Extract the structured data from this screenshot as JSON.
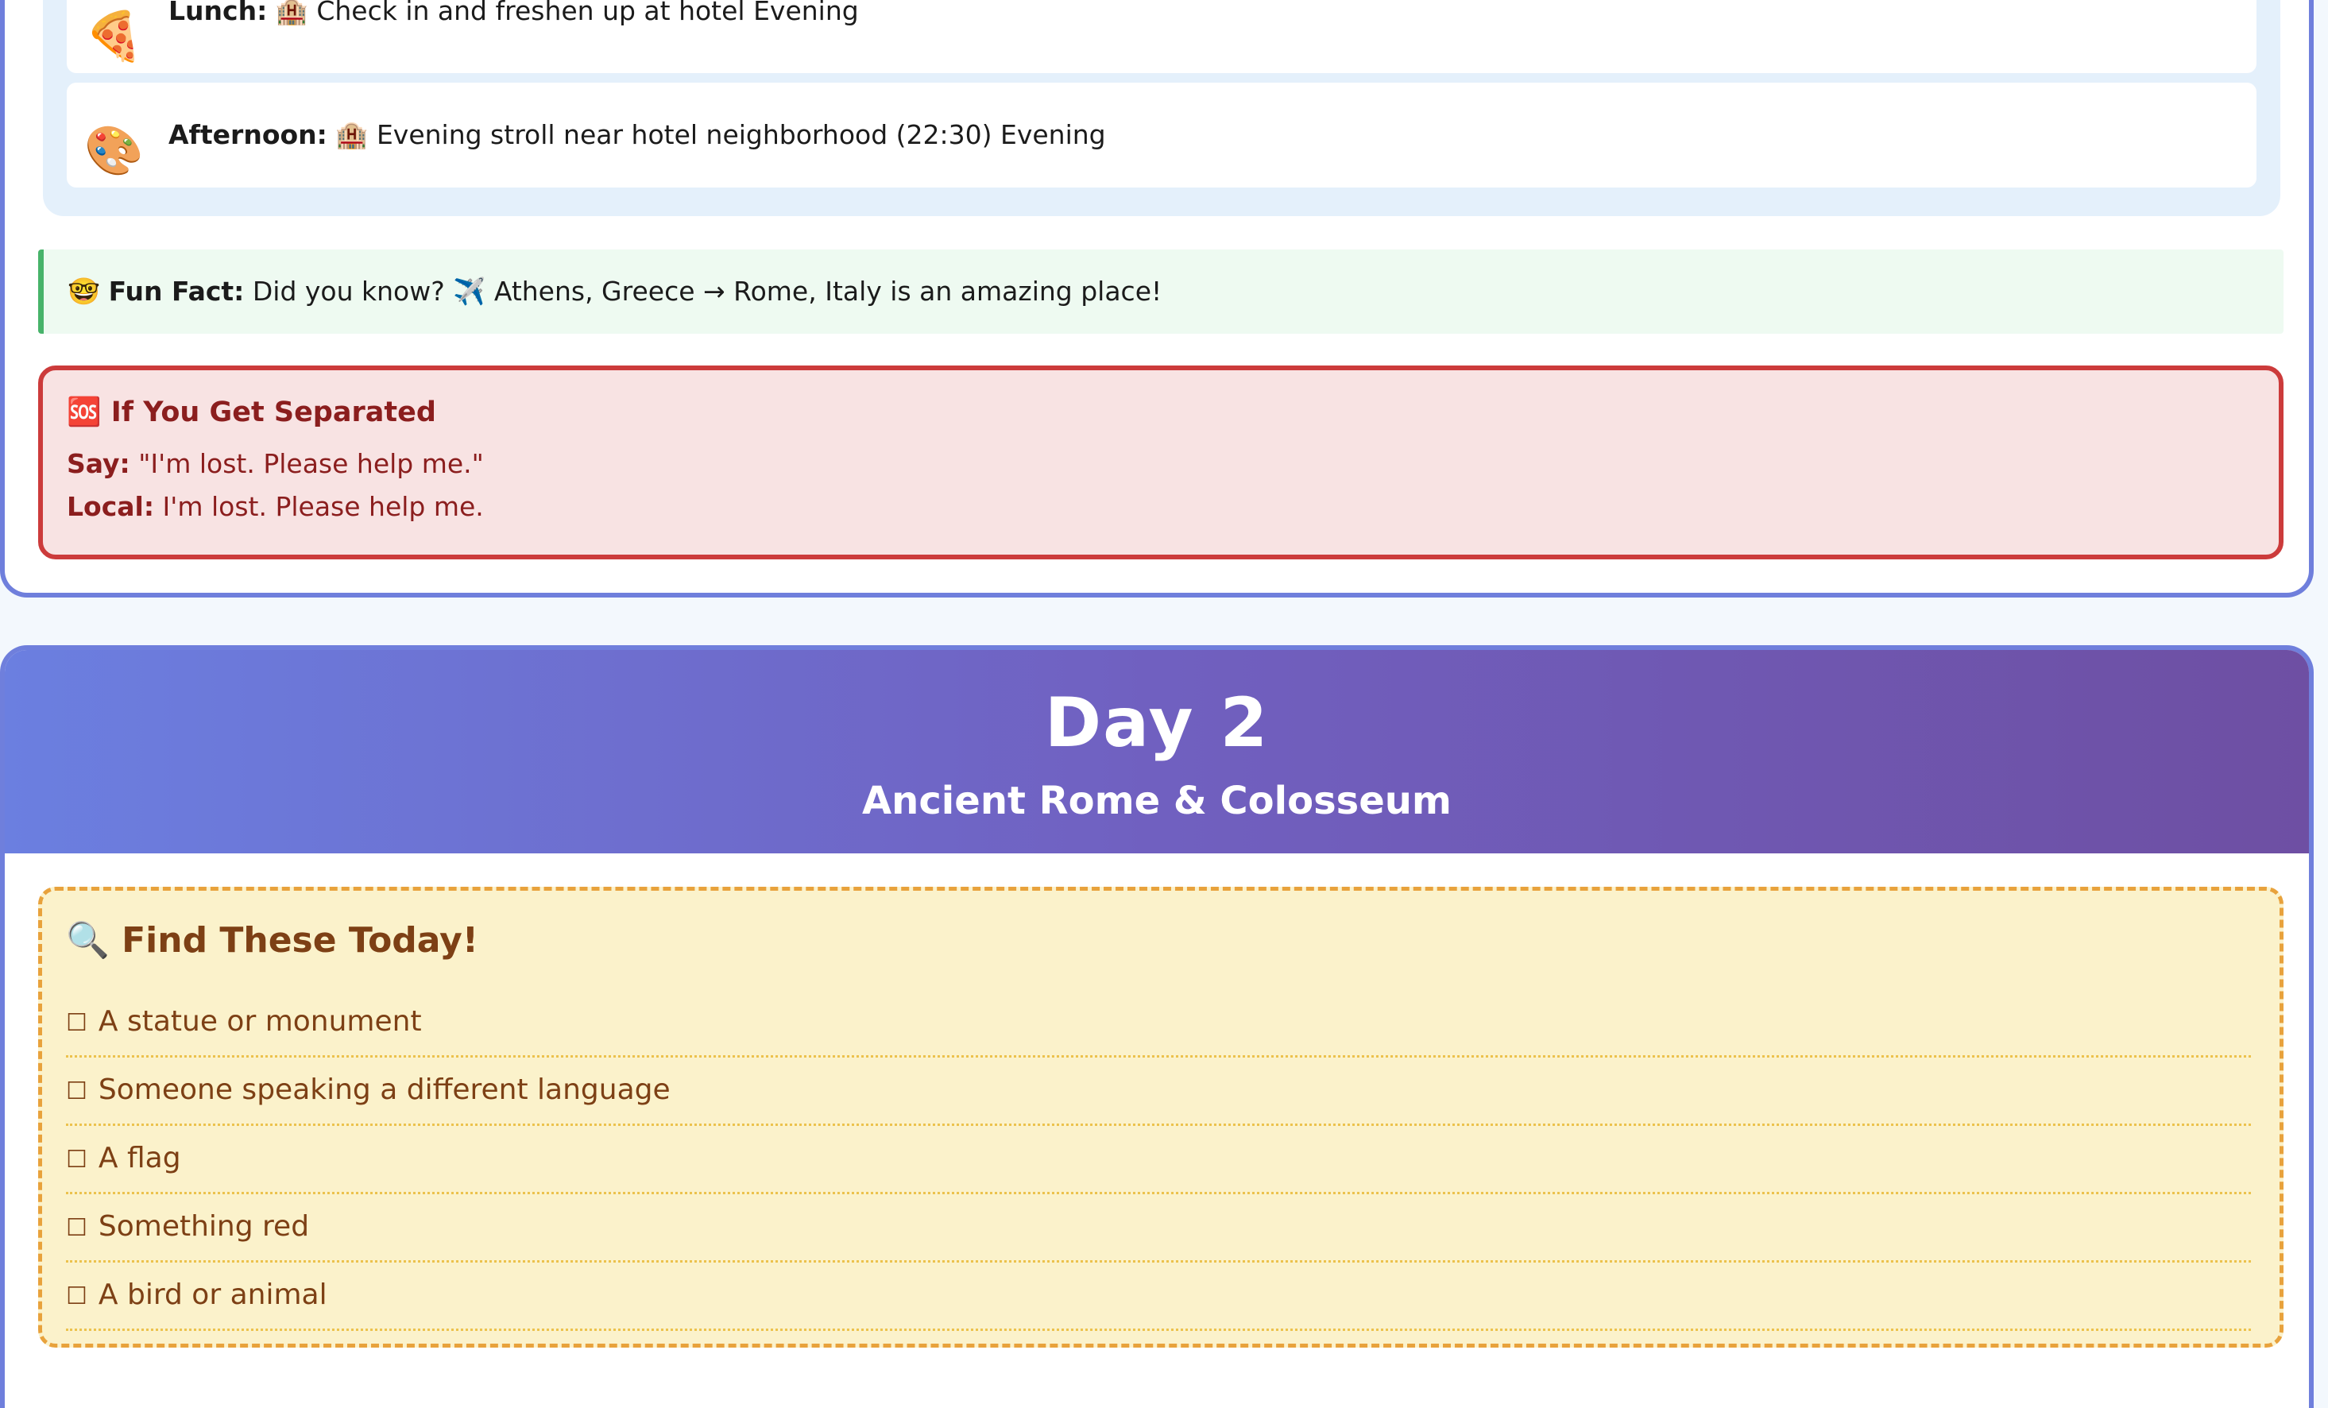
{
  "day1": {
    "activities": [
      {
        "emoji": "🍕",
        "icon": "pizza-icon",
        "label": "Lunch:",
        "text": "🏨 Check in and freshen up at hotel Evening"
      },
      {
        "emoji": "🎨",
        "icon": "palette-icon",
        "label": "Afternoon:",
        "text": "🏨 Evening stroll near hotel neighborhood (22:30) Evening"
      }
    ],
    "fun_fact": {
      "emoji": "🤓",
      "label": "Fun Fact:",
      "text": "Did you know? ✈️ Athens, Greece → Rome, Italy is an amazing place!"
    },
    "separated": {
      "title": "🆘 If You Get Separated",
      "say_label": "Say:",
      "say_text": "\"I'm lost. Please help me.\"",
      "local_label": "Local:",
      "local_text": "I'm lost. Please help me."
    }
  },
  "day2": {
    "title": "Day 2",
    "subtitle": "Ancient Rome & Colosseum",
    "find": {
      "title": "🔍 Find These Today!",
      "checkbox": "☐",
      "items": [
        "A statue or monument",
        "Someone speaking a different language",
        "A flag",
        "Something red",
        "A bird or animal"
      ]
    }
  },
  "colors": {
    "card_border": "#6f7fdc",
    "header_gradient_start": "#6b7fe0",
    "header_gradient_end": "#6e4fa3",
    "fun_fact_accent": "#47b36a",
    "sos_border": "#cc3b3b",
    "find_border": "#e8a23c"
  }
}
